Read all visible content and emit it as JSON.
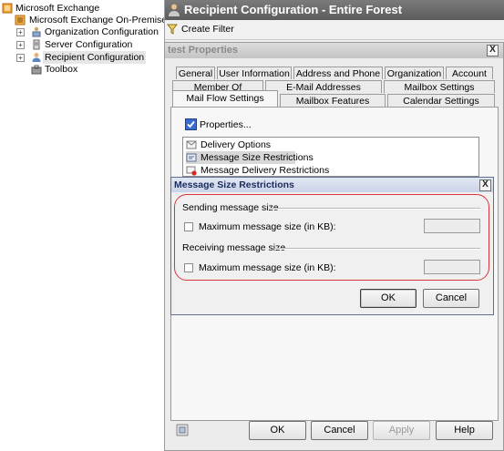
{
  "tree": {
    "root": "Microsoft Exchange",
    "onprem": "Microsoft Exchange On-Premises (e",
    "items": [
      {
        "label": "Organization Configuration",
        "expander": "+"
      },
      {
        "label": "Server Configuration",
        "expander": "+"
      },
      {
        "label": "Recipient Configuration",
        "expander": "+"
      },
      {
        "label": "Toolbox",
        "expander": ""
      }
    ]
  },
  "main": {
    "title": "Recipient Configuration - Entire Forest",
    "create_filter": "Create Filter"
  },
  "props": {
    "title": "test Properties",
    "close": "X",
    "tabs_row1": [
      "General",
      "User Information",
      "Address and Phone",
      "Organization",
      "Account"
    ],
    "tabs_row2": [
      "Member Of",
      "E-Mail Addresses",
      "Mailbox Settings"
    ],
    "tabs_row3": [
      "Mail Flow Settings",
      "Mailbox Features",
      "Calendar Settings"
    ],
    "properties_button": "Properties...",
    "list": [
      "Delivery Options",
      "Message Size Restrictions",
      "Message Delivery Restrictions"
    ],
    "buttons": {
      "ok": "OK",
      "cancel": "Cancel",
      "apply": "Apply",
      "help": "Help"
    }
  },
  "msr": {
    "title": "Message Size Restrictions",
    "close": "X",
    "sending_label": "Sending message size",
    "sending_chk": "Maximum message size (in KB):",
    "receiving_label": "Receiving message size",
    "receiving_chk": "Maximum message size (in KB):",
    "ok": "OK",
    "cancel": "Cancel"
  },
  "colors": {
    "highlight": "#d9343c",
    "selection": "#e6e6e6"
  }
}
